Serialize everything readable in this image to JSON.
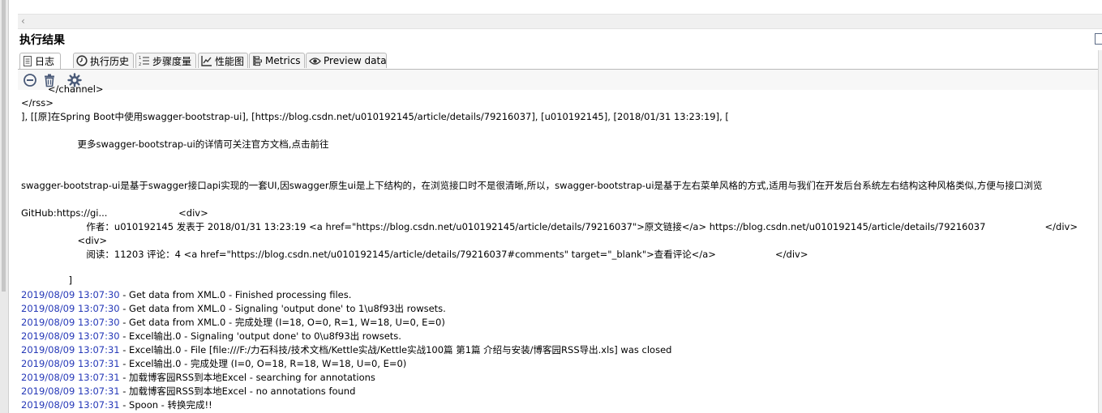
{
  "panel": {
    "title": "执行结果"
  },
  "tabs": [
    {
      "label": "日志",
      "icon": "log-icon"
    },
    {
      "label": "执行历史",
      "icon": "history-icon"
    },
    {
      "label": "步骤度量",
      "icon": "step-metrics-icon"
    },
    {
      "label": "性能图",
      "icon": "performance-chart-icon"
    },
    {
      "label": "Metrics",
      "icon": "metrics-icon"
    },
    {
      "label": "Preview data",
      "icon": "preview-eye-icon"
    }
  ],
  "toolbar": {
    "icons": [
      "stop-icon",
      "trash-icon",
      "settings-icon"
    ]
  },
  "log": {
    "lines": [
      "         </channel>",
      "</rss>",
      "], [[原]在Spring Boot中使用swagger-bootstrap-ui], [https://blog.csdn.net/u010192145/article/details/79216037], [u010192145], [2018/01/31 13:23:19], [",
      "",
      "                   更多swagger-bootstrap-ui的详情可关注官方文档,点击前往",
      "",
      "",
      "",
      "swagger-bootstrap-ui是基于swagger接口api实现的一套UI,因swagger原生ui是上下结构的，在浏览接口时不是很清晰,所以，swagger-bootstrap-ui是基于左右菜单风格的方式,适用与我们在开发后台系统左右结构这种风格类似,方便与接口浏览",
      "",
      "GitHub:https://gi...                        <div>",
      "                      作者：u010192145 发表于 2018/01/31 13:23:19 <a href=\"https://blog.csdn.net/u010192145/article/details/79216037\">原文链接</a> https://blog.csdn.net/u010192145/article/details/79216037                    </div>",
      "                   <div>",
      "                      阅读：11203 评论：4 <a href=\"https://blog.csdn.net/u010192145/article/details/79216037#comments\" target=\"_blank\">查看评论</a>                    </div>",
      "",
      "                ]"
    ],
    "entries": [
      {
        "ts": "2019/08/09 13:07:30",
        "msg": " - Get data from XML.0 - Finished processing files."
      },
      {
        "ts": "2019/08/09 13:07:30",
        "msg": " - Get data from XML.0 - Signaling 'output done' to 1\\u8f93出 rowsets."
      },
      {
        "ts": "2019/08/09 13:07:30",
        "msg": " - Get data from XML.0 - 完成处理 (I=18, O=0, R=1, W=18, U=0, E=0)"
      },
      {
        "ts": "2019/08/09 13:07:30",
        "msg": " - Excel输出.0 - Signaling 'output done' to 0\\u8f93出 rowsets."
      },
      {
        "ts": "2019/08/09 13:07:31",
        "msg": " - Excel输出.0 - File [file:///F:/力石科技/技术文档/Kettle实战/Kettle实战100篇 第1篇 介绍与安装/博客园RSS导出.xls] was closed"
      },
      {
        "ts": "2019/08/09 13:07:31",
        "msg": " - Excel输出.0 - 完成处理 (I=0, O=18, R=18, W=18, U=0, E=0)"
      },
      {
        "ts": "2019/08/09 13:07:31",
        "msg": " - 加载博客园RSS到本地Excel - searching for annotations"
      },
      {
        "ts": "2019/08/09 13:07:31",
        "msg": " - 加载博客园RSS到本地Excel - no annotations found"
      },
      {
        "ts": "2019/08/09 13:07:31",
        "msg": " - Spoon - 转换完成!!"
      }
    ]
  },
  "colors": {
    "timestamp": "#2538b8",
    "toolbar_icon": "#4a5a78"
  }
}
